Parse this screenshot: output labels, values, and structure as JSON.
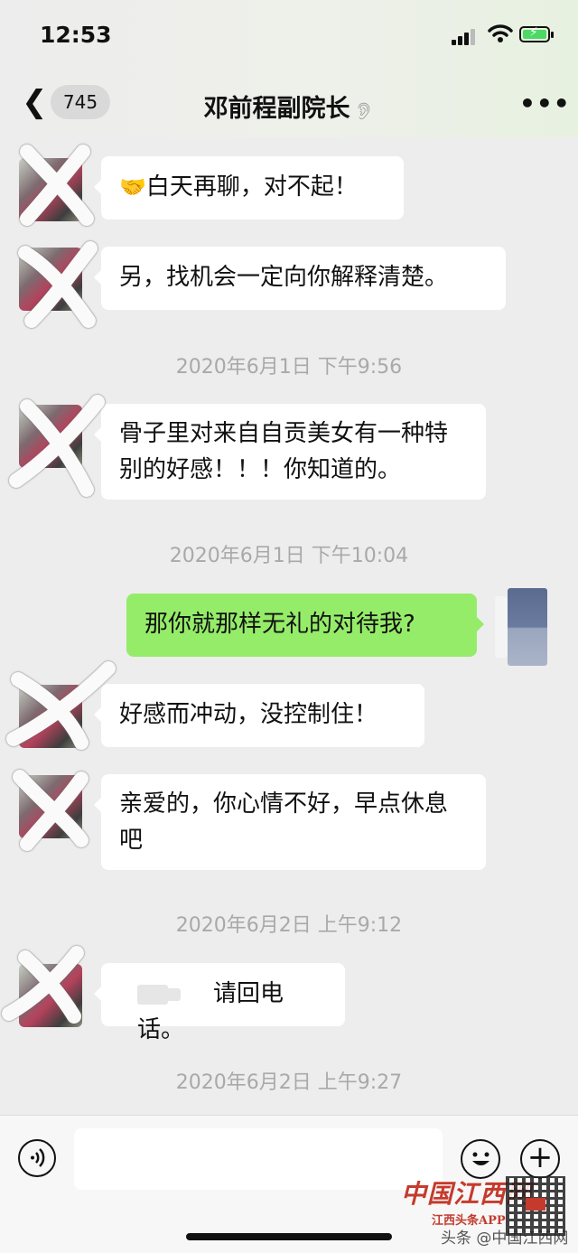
{
  "status_bar": {
    "time": "12:53"
  },
  "header": {
    "back_count": "745",
    "title": "邓前程副院长"
  },
  "messages": [
    {
      "type": "received",
      "emoji": "🤝",
      "text": "白天再聊，对不起！"
    },
    {
      "type": "received",
      "text": "另，找机会一定向你解释清楚。"
    },
    {
      "type": "timestamp",
      "text": "2020年6月1日 下午9:56"
    },
    {
      "type": "received",
      "text": "骨子里对来自自贡美女有一种特别的好感！！！你知道的。"
    },
    {
      "type": "timestamp",
      "text": "2020年6月1日 下午10:04"
    },
    {
      "type": "sent",
      "text": "那你就那样无礼的对待我?"
    },
    {
      "type": "received",
      "text": "好感而冲动，没控制住！"
    },
    {
      "type": "received",
      "text": "亲爱的，你心情不好，早点休息吧"
    },
    {
      "type": "timestamp",
      "text": "2020年6月2日 上午9:12"
    },
    {
      "type": "received_call",
      "text": "请回电话。"
    },
    {
      "type": "timestamp",
      "text": "2020年6月2日 上午9:27"
    }
  ],
  "input_bar": {
    "voice_icon": "voice-icon",
    "emoji_icon": "emoji-icon",
    "plus_icon": "plus-icon"
  },
  "watermark": {
    "logo_text": "中国江西网",
    "sub_text": "江西头条APP",
    "source_text": "头条 @中国江西网"
  },
  "colors": {
    "sent_bubble": "#95ec69",
    "received_bubble": "#ffffff",
    "background": "#ededed",
    "watermark": "#c43b2d"
  }
}
